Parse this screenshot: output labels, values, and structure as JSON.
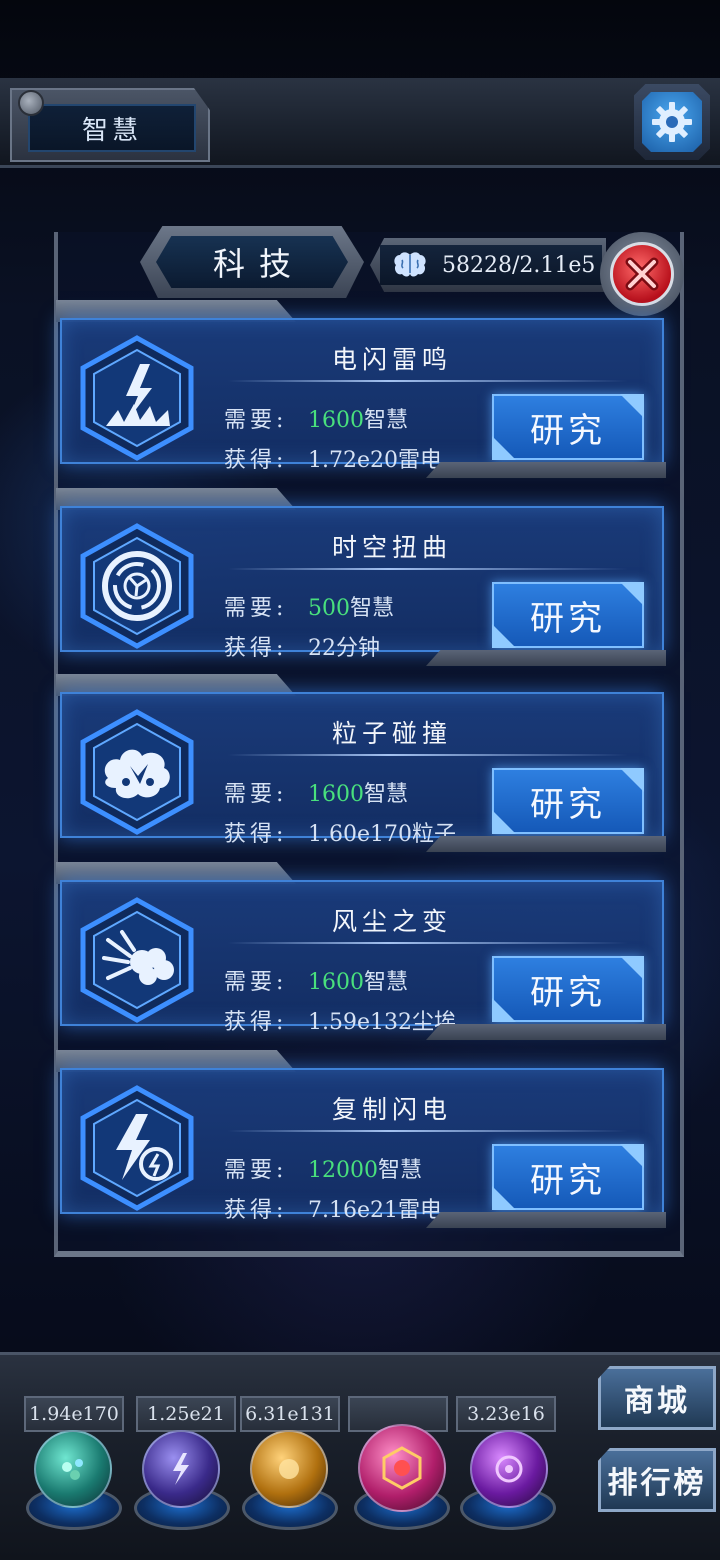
{
  "header": {
    "mode_label": "智慧",
    "settings_icon": "gear-icon"
  },
  "panel": {
    "title": "科技",
    "resource_icon": "brain-icon",
    "resource_value": "58228/2.11e5",
    "close_icon": "close-x-icon"
  },
  "labels": {
    "require": "需要:",
    "gain": "获得:"
  },
  "techs": [
    {
      "name": "电闪雷鸣",
      "icon": "lightning-strike-icon",
      "cost": "1600",
      "cost_unit": "智慧",
      "gain": "1.72e20雷电",
      "button": "研究"
    },
    {
      "name": "时空扭曲",
      "icon": "vortex-icon",
      "cost": "500",
      "cost_unit": "智慧",
      "gain": "22分钟",
      "button": "研究"
    },
    {
      "name": "粒子碰撞",
      "icon": "particle-collision-icon",
      "cost": "1600",
      "cost_unit": "智慧",
      "gain": "1.60e170粒子",
      "button": "研究"
    },
    {
      "name": "风尘之变",
      "icon": "dust-wind-icon",
      "cost": "1600",
      "cost_unit": "智慧",
      "gain": "1.59e132尘埃",
      "button": "研究"
    },
    {
      "name": "复制闪电",
      "icon": "copy-lightning-icon",
      "cost": "12000",
      "cost_unit": "智慧",
      "gain": "7.16e21雷电",
      "button": "研究"
    }
  ],
  "resources": [
    {
      "value": "1.94e170",
      "icon": "particle-orb-icon",
      "color": "#2fb3a0"
    },
    {
      "value": "1.25e21",
      "icon": "lightning-orb-icon",
      "color": "#6a5fc8"
    },
    {
      "value": "6.31e131",
      "icon": "dust-orb-icon",
      "color": "#d89a2a"
    },
    {
      "value": "",
      "icon": "wisdom-orb-icon",
      "color": "#d83a8a"
    },
    {
      "value": "3.23e16",
      "icon": "time-orb-icon",
      "color": "#9a3ad8"
    }
  ],
  "side_buttons": {
    "shop": "商城",
    "ranking": "排行榜"
  },
  "colors": {
    "cost_value": "#49e07d",
    "card_bg": "#1b3e80",
    "button_bg": "#2e7fe0"
  }
}
